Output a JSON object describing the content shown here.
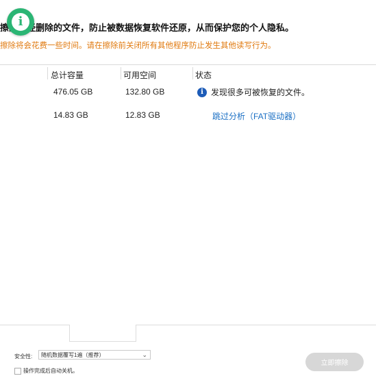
{
  "header": {
    "title": "擦除已经删除的文件，防止被数据恢复软件还原，从而保护您的个人隐私。",
    "warning": "擦除将会花费一些时间。请在擦除前关闭所有其他程序防止发生其他读写行为。"
  },
  "table": {
    "columns": [
      "总计容量",
      "可用空间",
      "状态"
    ],
    "rows": [
      {
        "total": "476.05 GB",
        "free": "132.80 GB",
        "status": "发现很多可被恢复的文件。",
        "status_type": "info"
      },
      {
        "total": "14.83 GB",
        "free": "12.83 GB",
        "status": "跳过分析（FAT驱动器）",
        "status_type": "link"
      }
    ]
  },
  "footer": {
    "security_label": "安全性:",
    "security_value": "随机数据覆写1遍（推荐）",
    "shutdown_label": "操作完成后自动关机。",
    "erase_button": "立即擦除"
  },
  "colors": {
    "warning": "#e07a10",
    "link": "#1a6fc4",
    "info_icon": "#1d5cb8",
    "fab": "#2bb574",
    "button_disabled": "#d7d7d7"
  }
}
